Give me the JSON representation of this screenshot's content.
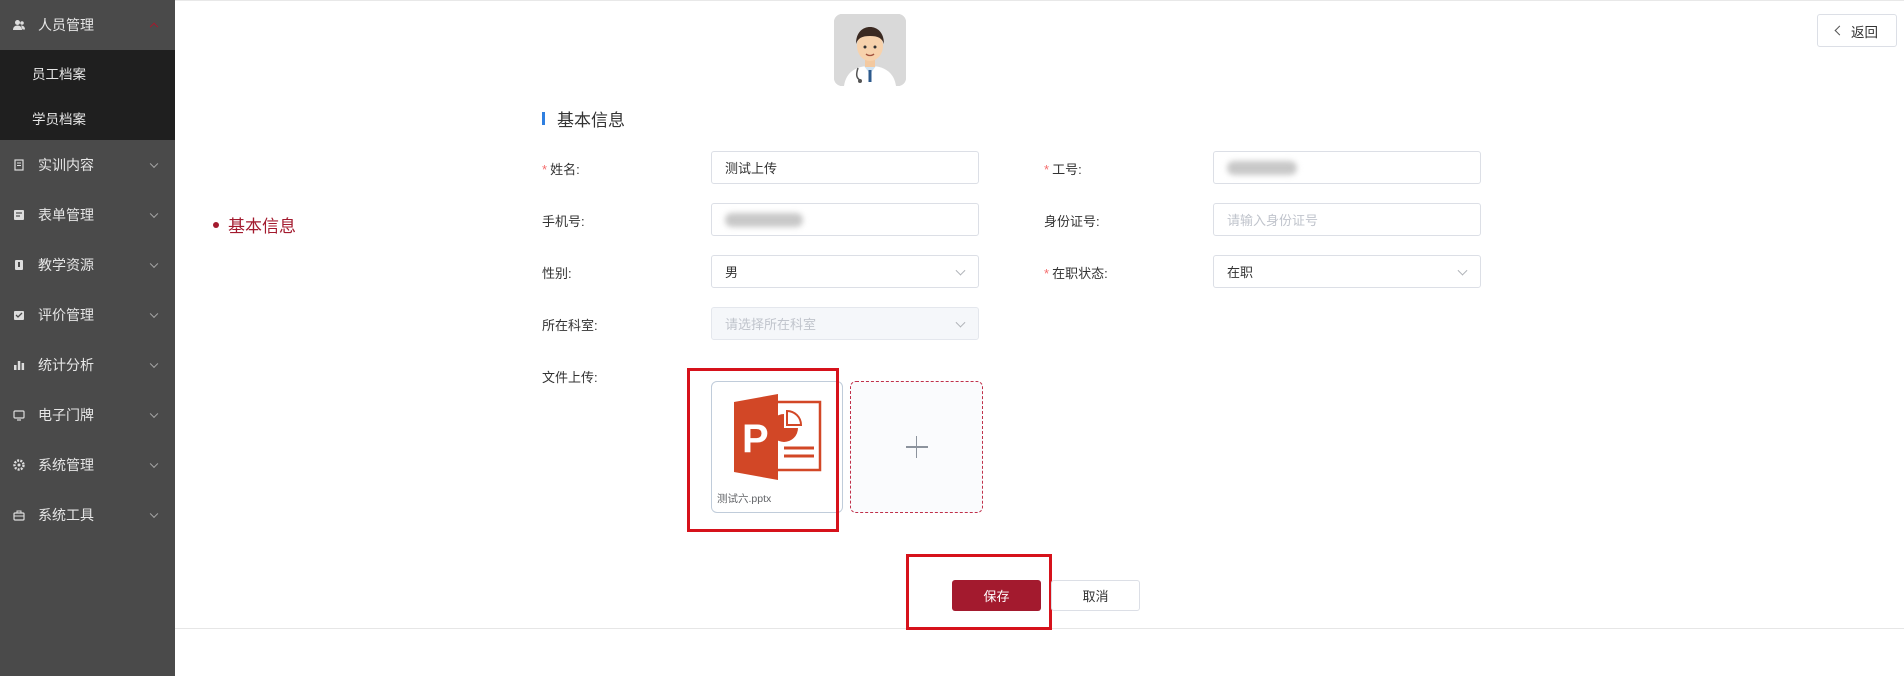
{
  "sidebar": {
    "items": [
      {
        "label": "人员管理",
        "icon": "user-icon",
        "open": true
      },
      {
        "label": "实训内容",
        "icon": "document-icon"
      },
      {
        "label": "表单管理",
        "icon": "form-icon"
      },
      {
        "label": "教学资源",
        "icon": "book-icon"
      },
      {
        "label": "评价管理",
        "icon": "evaluation-icon"
      },
      {
        "label": "统计分析",
        "icon": "bar-chart-icon"
      },
      {
        "label": "电子门牌",
        "icon": "monitor-icon"
      },
      {
        "label": "系统管理",
        "icon": "gear-icon"
      },
      {
        "label": "系统工具",
        "icon": "toolbox-icon"
      }
    ],
    "submenu": [
      {
        "label": "员工档案"
      },
      {
        "label": "学员档案"
      }
    ]
  },
  "header": {
    "back_label": "返回",
    "avatar_icon": "doctor-avatar-icon"
  },
  "anchor_nav": {
    "label": "基本信息"
  },
  "form": {
    "section_title": "基本信息",
    "name": {
      "label": "姓名:",
      "required": true,
      "value": "测试上传"
    },
    "employee_id": {
      "label": "工号:",
      "required": true
    },
    "phone": {
      "label": "手机号:"
    },
    "id_card": {
      "label": "身份证号:",
      "placeholder": "请输入身份证号"
    },
    "gender": {
      "label": "性别:",
      "value": "男"
    },
    "employment_status": {
      "label": "在职状态:",
      "required": true,
      "value": "在职"
    },
    "department": {
      "label": "所在科室:",
      "placeholder": "请选择所在科室",
      "disabled": true
    },
    "file_upload": {
      "label": "文件上传:",
      "files": [
        {
          "name": "测试六.pptx",
          "icon": "powerpoint-file-icon"
        }
      ],
      "add_icon": "plus-icon"
    }
  },
  "actions": {
    "save_label": "保存",
    "cancel_label": "取消"
  },
  "colors": {
    "sidebar_bg": "#4a4a4a",
    "submenu_bg": "#1f1f1f",
    "accent": "#a31a2e",
    "section_bar": "#2f7fe0",
    "required": "#f56c6c",
    "highlight_box": "#d6121b"
  }
}
